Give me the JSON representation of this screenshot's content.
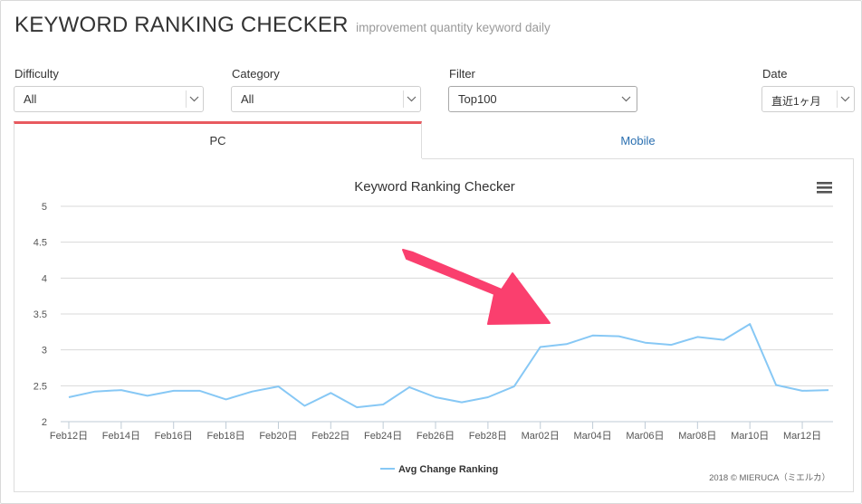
{
  "header": {
    "title": "KEYWORD RANKING CHECKER",
    "subtitle": "improvement quantity keyword daily"
  },
  "filters": {
    "difficulty": {
      "label": "Difficulty",
      "value": "All"
    },
    "category": {
      "label": "Category",
      "value": "All"
    },
    "filter": {
      "label": "Filter",
      "value": "Top100"
    },
    "date": {
      "label": "Date",
      "value": "直近1ヶ月"
    }
  },
  "tabs": {
    "pc": "PC",
    "mobile": "Mobile"
  },
  "chart_data": {
    "type": "line",
    "title": "Keyword Ranking Checker",
    "xlabel": "",
    "ylabel": "",
    "ylim": [
      2,
      5
    ],
    "yticks": [
      "5",
      "4.5",
      "4",
      "3.5",
      "3",
      "2.5",
      "2"
    ],
    "xticks": [
      "Feb12日",
      "Feb14日",
      "Feb16日",
      "Feb18日",
      "Feb20日",
      "Feb22日",
      "Feb24日",
      "Feb26日",
      "Feb28日",
      "Mar02日",
      "Mar04日",
      "Mar06日",
      "Mar08日",
      "Mar10日",
      "Mar12日"
    ],
    "grid": true,
    "legend": "bottom-center",
    "series": [
      {
        "name": "Avg Change Ranking",
        "color": "#87c8f5",
        "x": [
          "Feb12",
          "Feb13",
          "Feb14",
          "Feb15",
          "Feb16",
          "Feb17",
          "Feb18",
          "Feb19",
          "Feb20",
          "Feb21",
          "Feb22",
          "Feb23",
          "Feb24",
          "Feb25",
          "Feb26",
          "Feb27",
          "Feb28",
          "Mar01",
          "Mar02",
          "Mar03",
          "Mar04",
          "Mar05",
          "Mar06",
          "Mar07",
          "Mar08",
          "Mar09",
          "Mar10",
          "Mar11",
          "Mar12",
          "Mar13"
        ],
        "values": [
          2.34,
          2.42,
          2.44,
          2.36,
          2.43,
          2.43,
          2.31,
          2.42,
          2.49,
          2.22,
          2.4,
          2.2,
          2.24,
          2.48,
          2.34,
          2.27,
          2.34,
          2.49,
          3.04,
          3.08,
          3.2,
          3.19,
          3.1,
          3.07,
          3.18,
          3.14,
          3.36,
          2.51,
          2.43,
          2.44
        ]
      }
    ]
  },
  "chart_menu_icon": "hamburger-menu-icon",
  "annotation_arrow": {
    "color": "#fa3f6e"
  },
  "credits": "2018 © MIERUCA（ミエルカ）"
}
